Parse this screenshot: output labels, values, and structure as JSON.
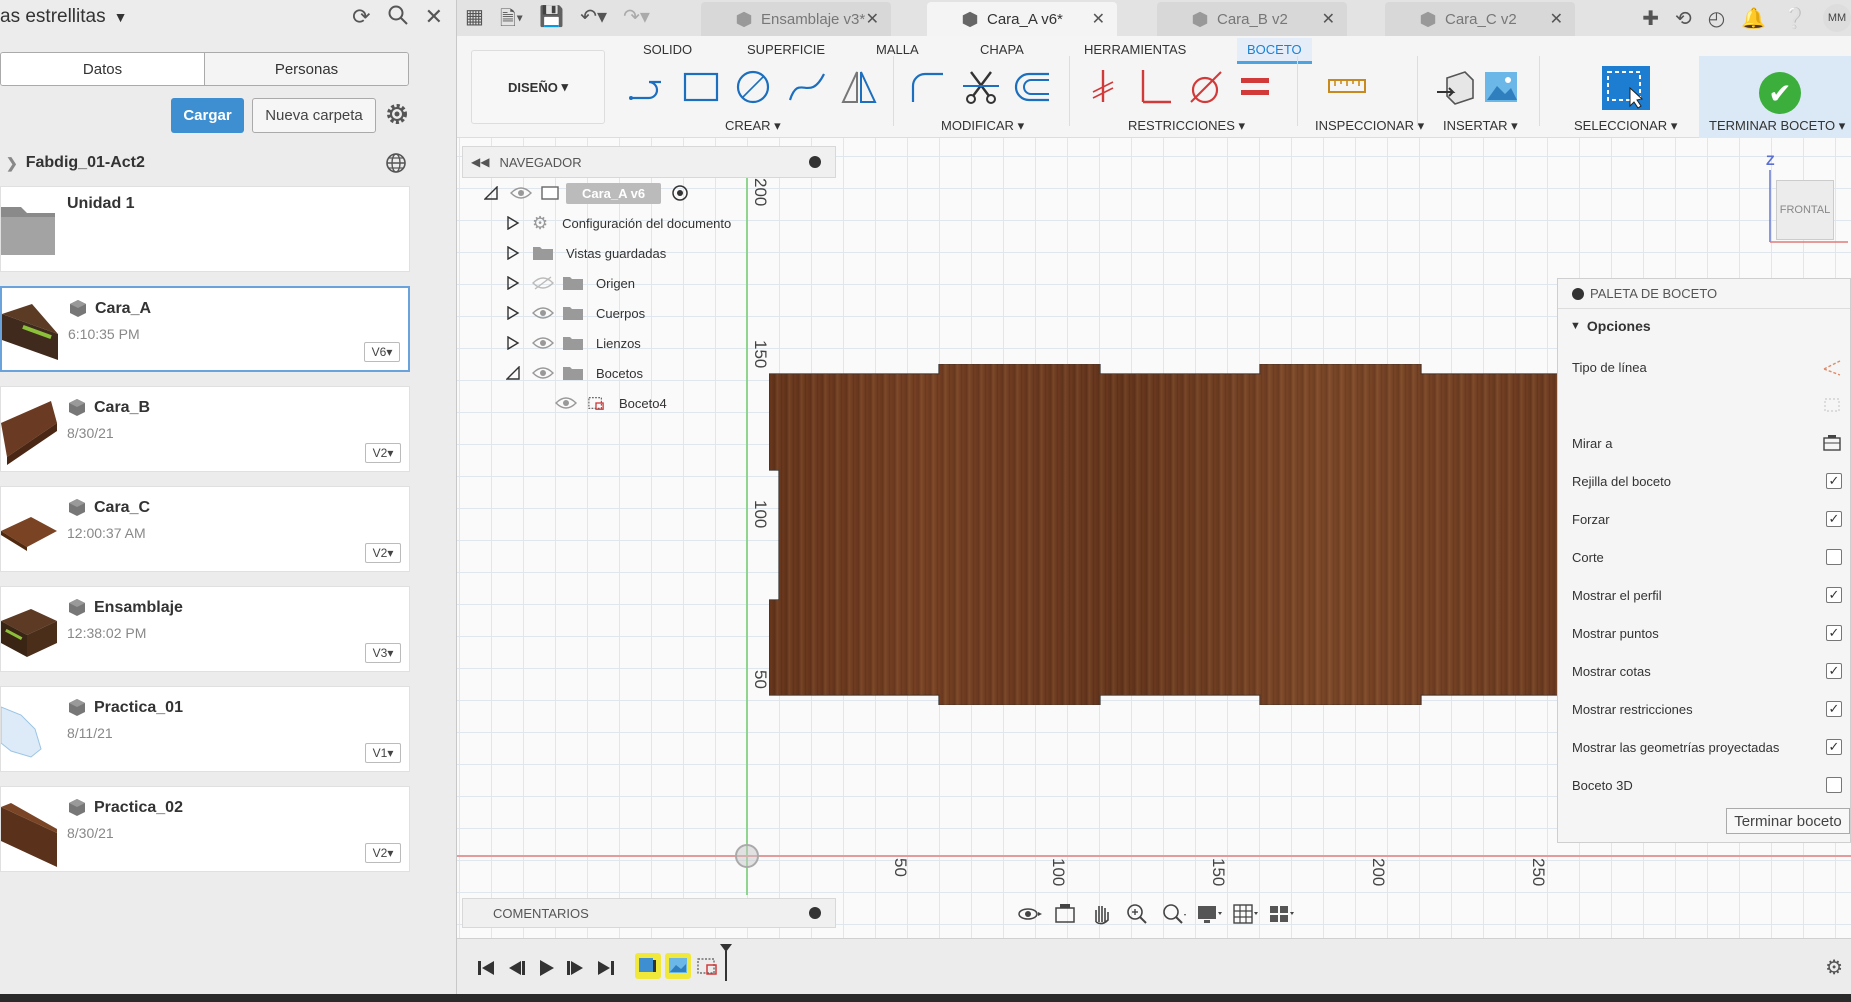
{
  "data_panel": {
    "title": "as estrellitas",
    "tabs": [
      "Datos",
      "Personas"
    ],
    "upload_label": "Cargar",
    "new_folder_label": "Nueva carpeta",
    "project": "Fabdig_01-Act2",
    "folder": {
      "name": "Unidad 1"
    },
    "files": [
      {
        "name": "Cara_A",
        "date": "6:10:35 PM",
        "version": "V6"
      },
      {
        "name": "Cara_B",
        "date": "8/30/21",
        "version": "V2"
      },
      {
        "name": "Cara_C",
        "date": "12:00:37 AM",
        "version": "V2"
      },
      {
        "name": "Ensamblaje",
        "date": "12:38:02 PM",
        "version": "V3"
      },
      {
        "name": "Practica_01",
        "date": "8/11/21",
        "version": "V1"
      },
      {
        "name": "Practica_02",
        "date": "8/30/21",
        "version": "V2"
      }
    ]
  },
  "doc_tabs": [
    "Ensamblaje v3*",
    "Cara_A v6*",
    "Cara_B v2",
    "Cara_C v2"
  ],
  "user_initials": "MM",
  "ribbon": {
    "workspace": "DISEÑO",
    "tabs": [
      "SOLIDO",
      "SUPERFICIE",
      "MALLA",
      "CHAPA",
      "HERRAMIENTAS",
      "BOCETO"
    ],
    "groups": [
      "CREAR",
      "MODIFICAR",
      "RESTRICCIONES",
      "INSPECCIONAR",
      "INSERTAR",
      "SELECCIONAR",
      "TERMINAR BOCETO"
    ]
  },
  "browser": {
    "title": "NAVEGADOR",
    "root": "Cara_A v6",
    "items": [
      "Configuración del documento",
      "Vistas guardadas",
      "Origen",
      "Cuerpos",
      "Lienzos",
      "Bocetos",
      "Boceto4"
    ]
  },
  "comments_label": "COMENTARIOS",
  "viewcube": {
    "face": "FRONTAL",
    "axis": "Z"
  },
  "axis_ticks": {
    "vertical": [
      "200",
      "150",
      "100",
      "50"
    ],
    "horizontal": [
      "50",
      "100",
      "150",
      "200",
      "250"
    ]
  },
  "palette": {
    "title": "PALETA DE BOCETO",
    "section": "Opciones",
    "rows": [
      {
        "label": "Tipo de línea",
        "control": "icon",
        "checked": false
      },
      {
        "label": "",
        "control": "icon",
        "checked": false
      },
      {
        "label": "Mirar a",
        "control": "icon",
        "checked": false
      },
      {
        "label": "Rejilla del boceto",
        "control": "checkbox",
        "checked": true
      },
      {
        "label": "Forzar",
        "control": "checkbox",
        "checked": true
      },
      {
        "label": "Corte",
        "control": "checkbox",
        "checked": false
      },
      {
        "label": "Mostrar el perfil",
        "control": "checkbox",
        "checked": true
      },
      {
        "label": "Mostrar puntos",
        "control": "checkbox",
        "checked": true
      },
      {
        "label": "Mostrar cotas",
        "control": "checkbox",
        "checked": true
      },
      {
        "label": "Mostrar restricciones",
        "control": "checkbox",
        "checked": true
      },
      {
        "label": "Mostrar las geometrías proyectadas",
        "control": "checkbox",
        "checked": true
      },
      {
        "label": "Boceto 3D",
        "control": "checkbox",
        "checked": false
      }
    ],
    "finish_label": "Terminar boceto"
  }
}
